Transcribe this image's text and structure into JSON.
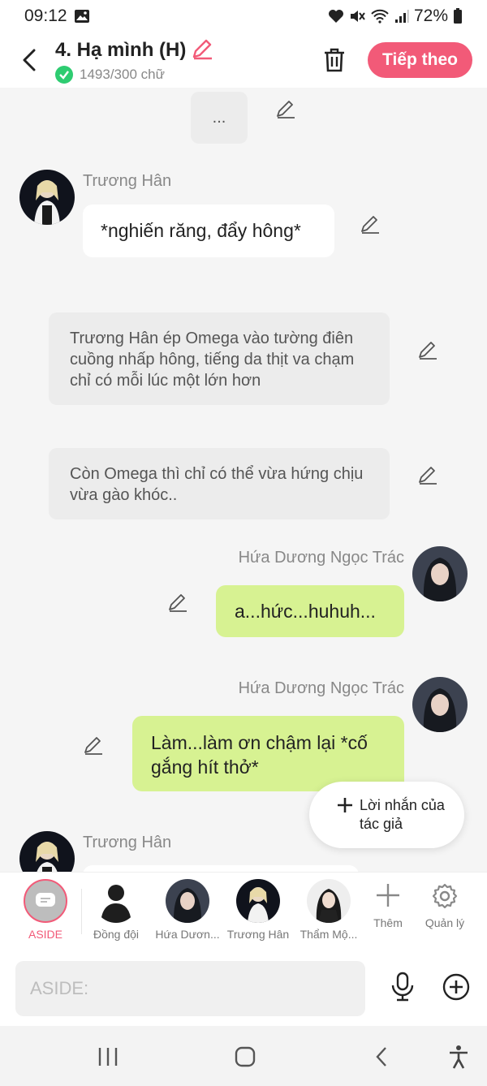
{
  "status_bar": {
    "time": "09:12",
    "battery": "72%"
  },
  "header": {
    "title": "4. Hạ mình (H)",
    "word_count": "1493/300 chữ",
    "next_label": "Tiếp theo"
  },
  "messages": {
    "m0": {
      "text": "..."
    },
    "m1": {
      "name": "Trương Hân",
      "text": "*nghiến răng, đẩy hông*"
    },
    "m2": {
      "text": "Trương Hân ép Omega vào tường điên cuồng nhấp hông, tiếng da thịt va chạm chỉ có mỗi lúc một lớn hơn"
    },
    "m3": {
      "text": "Còn Omega thì chỉ có thể vừa hứng chịu vừa gào khóc.."
    },
    "m4": {
      "name": "Hứa Dương Ngọc Trác",
      "text": "a...hức...huhuh..."
    },
    "m5": {
      "name": "Hứa Dương Ngọc Trác",
      "text": "Làm...làm ơn chậm lại *cố gắng hít thở*"
    },
    "m6": {
      "name": "Trương Hân"
    }
  },
  "author_note": {
    "label": "Lời nhắn của tác giả"
  },
  "character_bar": {
    "aside": "ASIDE",
    "teammate": "Đồng đội",
    "char1": "Hứa Dươn...",
    "char2": "Trương Hân",
    "char3": "Thẩm Mộ...",
    "add": "Thêm",
    "manage": "Quản lý"
  },
  "input": {
    "placeholder": "ASIDE:"
  },
  "colors": {
    "accent": "#f25a78",
    "green_bubble": "#d7f292",
    "grey_bubble": "#ececec"
  }
}
